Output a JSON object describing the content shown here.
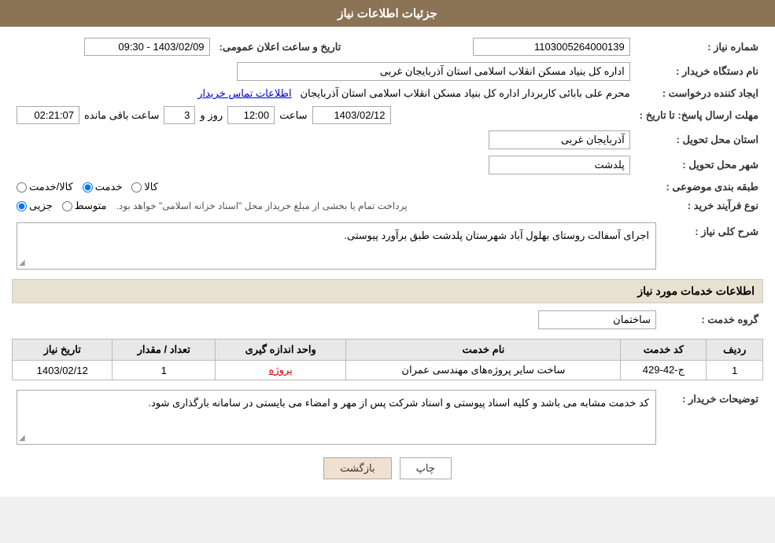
{
  "header": {
    "title": "جزئیات اطلاعات نیاز"
  },
  "fields": {
    "need_number_label": "شماره نیاز :",
    "need_number_value": "1103005264000139",
    "buyer_org_label": "نام دستگاه خریدار :",
    "buyer_org_value": "اداره کل بنیاد مسکن انقلاب اسلامی استان آذربایجان غربی",
    "creator_label": "ایجاد کننده درخواست :",
    "creator_value": "محرم علی بابائی کاربردار اداره کل بنیاد مسکن انقلاب اسلامی استان آذربایجان",
    "contact_link": "اطلاعات تماس خریدار",
    "deadline_label": "مهلت ارسال پاسخ: تا تاریخ :",
    "deadline_date": "1403/02/12",
    "deadline_time_label": "ساعت",
    "deadline_time": "12:00",
    "deadline_day_label": "روز و",
    "deadline_days": "3",
    "remaining_label": "ساعت باقی مانده",
    "remaining_time": "02:21:07",
    "announce_label": "تاریخ و ساعت اعلان عمومی:",
    "announce_value": "1403/02/09 - 09:30",
    "province_label": "استان محل تحویل :",
    "province_value": "آذربایجان غربی",
    "city_label": "شهر محل تحویل :",
    "city_value": "پلدشت",
    "category_label": "طبقه بندی موضوعی :",
    "category_options": [
      "کالا",
      "خدمت",
      "کالا/خدمت"
    ],
    "category_selected": "خدمت",
    "process_label": "نوع فرآیند خرید :",
    "process_options": [
      "جزیی",
      "متوسط"
    ],
    "process_note": "پرداخت تمام یا بخشی از مبلغ خریداز محل \"اسناد خزانه اسلامی\" خواهد بود.",
    "need_desc_label": "شرح کلی نیاز :",
    "need_desc_value": "اجرای آسفالت روستای بهلول آباد شهرستان پلدشت طبق برآورد پیوستی.",
    "services_section": "اطلاعات خدمات مورد نیاز",
    "service_group_label": "گروه خدمت :",
    "service_group_value": "ساختمان",
    "table_headers": [
      "ردیف",
      "کد خدمت",
      "نام خدمت",
      "واحد اندازه گیری",
      "تعداد / مقدار",
      "تاریخ نیاز"
    ],
    "table_rows": [
      {
        "row": "1",
        "code": "ج-42-429",
        "name": "ساخت سایر پروژه‌های مهندسی عمران",
        "unit": "پروژه",
        "qty": "1",
        "date": "1403/02/12"
      }
    ],
    "buyer_notes_label": "توضیحات خریدار :",
    "buyer_notes_value": "کد خدمت مشابه می باشد و کلیه اسناد پیوستی و اسناد شرکت پس از مهر و امضاء می بایستی در سامانه بارگذاری شود.",
    "btn_print": "چاپ",
    "btn_back": "بازگشت"
  }
}
